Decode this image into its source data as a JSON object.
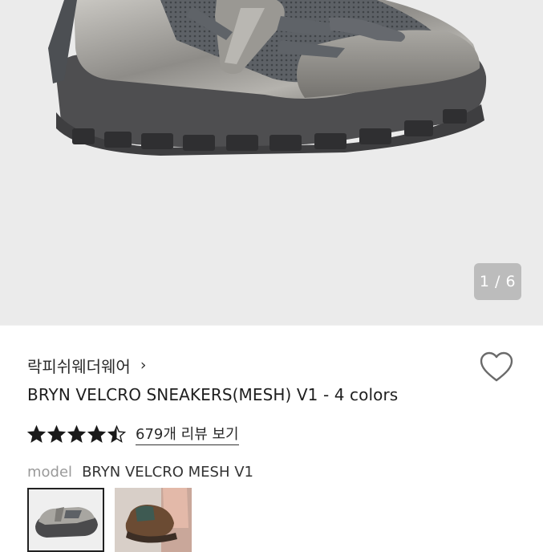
{
  "gallery": {
    "counter": "1 / 6",
    "image_icon": "shoe-photo"
  },
  "product": {
    "brand": "락피쉬웨더웨어",
    "brand_chevron": "›",
    "title": "BRYN VELCRO SNEAKERS(MESH) V1 - 4 colors",
    "rating": 4.5,
    "review_link": "679개 리뷰 보기",
    "model_label": "model",
    "model_value": "BRYN VELCRO MESH V1",
    "favorite_icon": "heart-outline-icon",
    "star_color": "#1a1a1a"
  },
  "thumbnails": [
    {
      "icon": "shoe-thumbnail-silver",
      "selected": true
    },
    {
      "icon": "shoe-thumbnail-worn",
      "selected": false
    }
  ]
}
